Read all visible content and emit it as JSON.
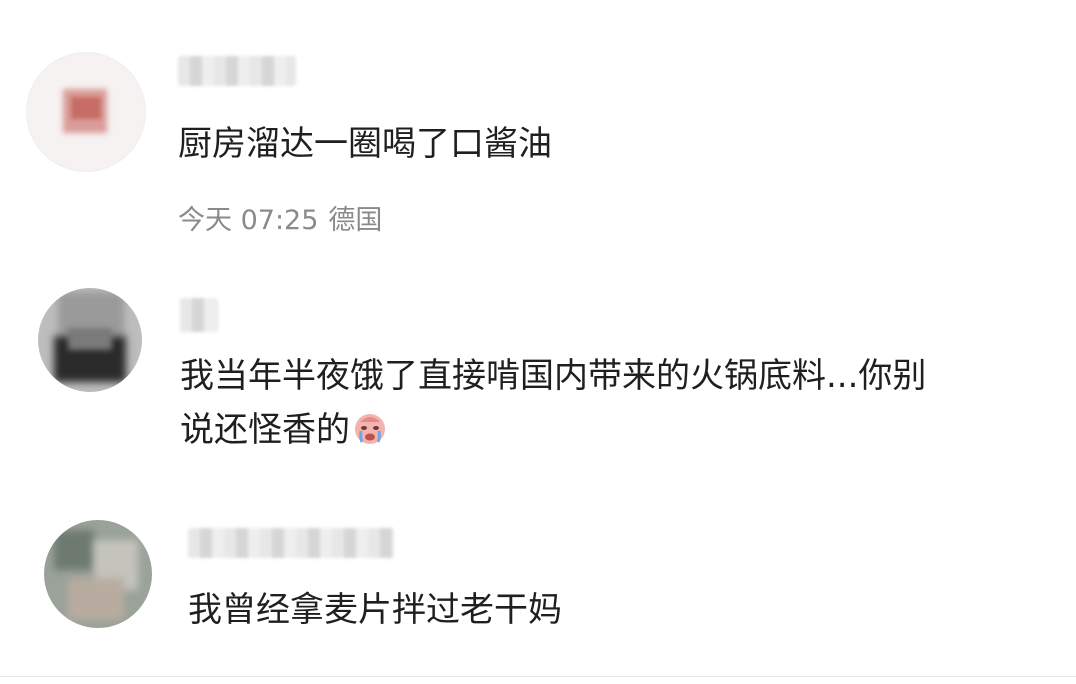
{
  "comments": [
    {
      "text": "厨房溜达一圈喝了口酱油",
      "time": "今天 07:25",
      "location": "德国"
    },
    {
      "text_line1": "我当年半夜饿了直接啃国内带来的火锅底料...你别",
      "text_line2": "说还怪香的"
    },
    {
      "text": "我曾经拿麦片拌过老干妈"
    }
  ],
  "emoji": {
    "name": "crying-face-emoji"
  },
  "colors": {
    "text": "#1f1f1f",
    "meta": "#8a8a8a",
    "background": "#ffffff"
  }
}
